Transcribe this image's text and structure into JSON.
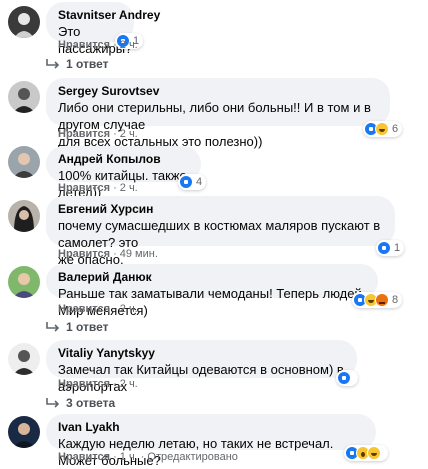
{
  "comments": [
    {
      "author": "Stavnitser Andrey",
      "lines": [
        "Это пассажиры?"
      ],
      "like_label": "Нравится",
      "time": "2 ч.",
      "reaction_count": "1",
      "reactions": [
        "like"
      ],
      "replies_label": "1 ответ"
    },
    {
      "author": "Sergey Surovtsev",
      "lines": [
        "Либо они стерильны, либо они больны!! И в том и в другом случае",
        "для всех остальных это полезно))"
      ],
      "like_label": "Нравится",
      "time": "2 ч.",
      "reaction_count": "6",
      "reactions": [
        "like",
        "haha"
      ],
      "replies_label": ""
    },
    {
      "author": "Андрей Копылов",
      "lines": [
        "100% китайцы. также летел))"
      ],
      "like_label": "Нравится",
      "time": "2 ч.",
      "reaction_count": "4",
      "reactions": [
        "like"
      ],
      "replies_label": ""
    },
    {
      "author": "Евгений Хурсин",
      "lines": [
        "почему сумасшедших в костюмах маляров пускают в самолет? это",
        "же опасно."
      ],
      "like_label": "Нравится",
      "time": "49 мин.",
      "reaction_count": "1",
      "reactions": [
        "like"
      ],
      "replies_label": ""
    },
    {
      "author": "Валерий Данюк",
      "lines": [
        "Раньше так заматывали чемоданы! Теперь людей. Мир меняется)"
      ],
      "like_label": "Нравится",
      "time": "2 ч.",
      "reaction_count": "8",
      "reactions": [
        "like",
        "haha",
        "angry"
      ],
      "replies_label": "1 ответ"
    },
    {
      "author": "Vitaliy Yanytskyy",
      "lines": [
        "Замечал так Китайцы одеваются в основном) в аэропортах"
      ],
      "like_label": "Нравится",
      "time": "2 ч.",
      "reaction_count": "",
      "reactions": [
        "like"
      ],
      "replies_label": "3 ответа"
    },
    {
      "author": "Ivan Lyakh",
      "lines": [
        "Каждую неделю летаю, но таких не встречал. Может больные?"
      ],
      "like_label": "Нравится",
      "time": "1 ч.",
      "extra": "Отредактировано",
      "reaction_count": "",
      "reactions": [
        "like",
        "wow",
        "haha"
      ],
      "replies_label": ""
    }
  ],
  "colors": {
    "bubble": "#f0f2f5",
    "meta": "#65676b",
    "like_blue": "#1877f2"
  }
}
